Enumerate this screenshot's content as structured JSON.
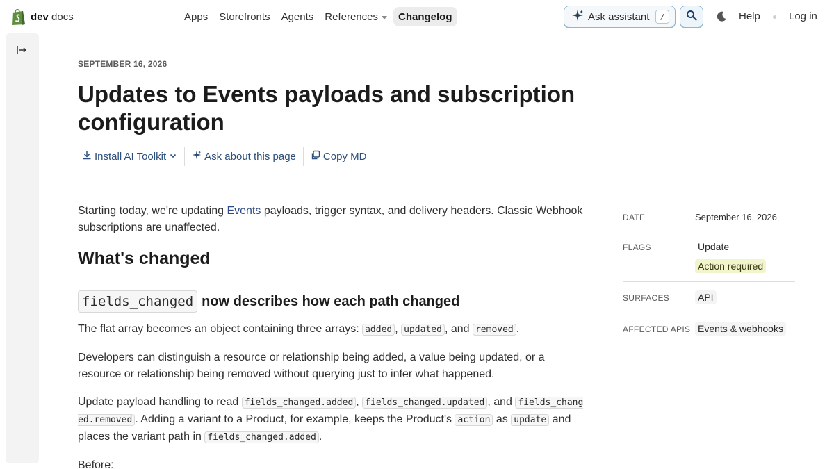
{
  "brand": {
    "name_bold": "dev",
    "name_light": "docs",
    "logo_icon": "shopping-bag-icon"
  },
  "nav": {
    "items": [
      {
        "label": "Apps"
      },
      {
        "label": "Storefronts"
      },
      {
        "label": "Agents"
      },
      {
        "label": "References",
        "has_dropdown": true
      },
      {
        "label": "Changelog",
        "active": true
      }
    ],
    "ask_assistant_label": "Ask assistant",
    "ask_assistant_shortcut": "/",
    "help_label": "Help",
    "login_label": "Log in"
  },
  "colors": {
    "accent_link": "#2e4a86",
    "action_required_bg": "#f2f4cc",
    "assistant_border": "#8fb6cf"
  },
  "article": {
    "date_kicker": "SEPTEMBER 16, 2026",
    "title": "Updates to Events payloads and subscription configuration",
    "actions": {
      "install": "Install AI Toolkit",
      "ask": "Ask about this page",
      "copy": "Copy MD"
    },
    "intro_before_link": "Starting today, we're updating ",
    "intro_link": "Events",
    "intro_after_link": " payloads, trigger syntax, and delivery headers. Classic Webhook subscriptions are unaffected.",
    "h2": "What's changed",
    "h3_code": "fields_changed",
    "h3_text": "now describes how each path changed",
    "p1": {
      "t1": "The flat array becomes an object containing three arrays: ",
      "c1": "added",
      "t2": ", ",
      "c2": "updated",
      "t3": ", and ",
      "c3": "removed",
      "t4": "."
    },
    "p2": "Developers can distinguish a resource or relationship being added, a value being updated, or a resource or relationship being removed without querying just to infer what happened.",
    "p3": {
      "t1": "Update payload handling to read ",
      "c1": "fields_changed.added",
      "t2": ", ",
      "c2": "fields_changed.updated",
      "t3": ", and ",
      "c3": "fields_changed.removed",
      "t4": ". Adding a variant to a Product, for example, keeps the Product's ",
      "c4": "action",
      "t5": " as ",
      "c5": "update",
      "t6": " and places the variant path in ",
      "c6": "fields_changed.added",
      "t7": "."
    },
    "before_label": "Before:"
  },
  "meta": {
    "date_key": "DATE",
    "date_value": "September 16, 2026",
    "flags_key": "FLAGS",
    "flags": [
      "Update",
      "Action required"
    ],
    "surfaces_key": "SURFACES",
    "surfaces": [
      "API"
    ],
    "affected_key": "AFFECTED APIS",
    "affected": [
      "Events & webhooks"
    ]
  }
}
